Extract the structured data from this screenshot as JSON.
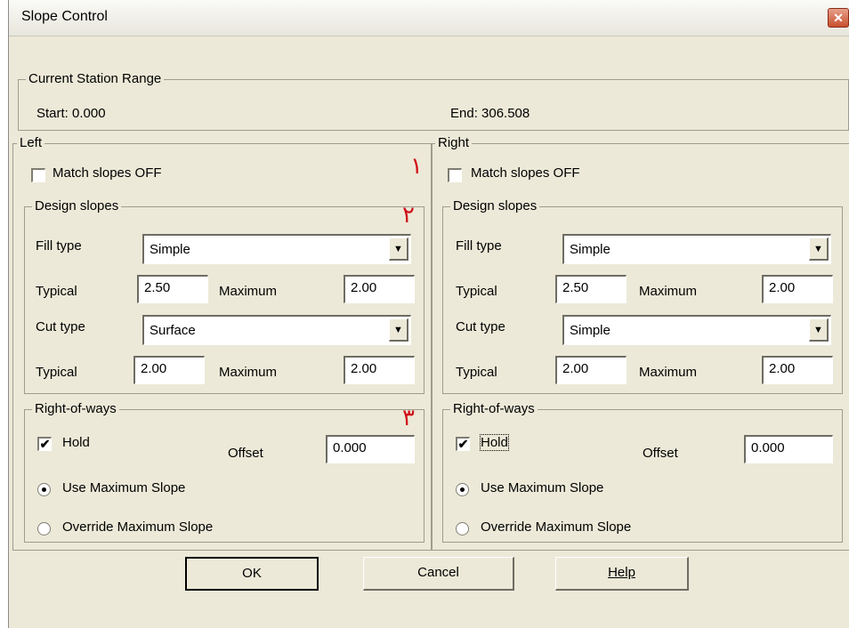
{
  "window": {
    "title": "Slope Control",
    "close_glyph": "✕"
  },
  "station": {
    "label": "Current Station Range",
    "start": "Start: 0.000",
    "end": "End: 306.508"
  },
  "left": {
    "label": "Left",
    "marker1": "١",
    "match": "Match slopes OFF",
    "design": {
      "label": "Design slopes",
      "marker": "٢",
      "fill_type_label": "Fill type",
      "fill_type_value": "Simple",
      "typical_label": "Typical",
      "fill_typical": "2.50",
      "maximum_label": "Maximum",
      "fill_maximum": "2.00",
      "cut_type_label": "Cut type",
      "cut_type_value": "Surface",
      "cut_typical": "2.00",
      "cut_maximum": "2.00"
    },
    "row": {
      "label": "Right-of-ways",
      "marker": "٣",
      "hold": "Hold",
      "hold_checked": "✔",
      "offset_label": "Offset",
      "offset_value": "0.000",
      "use_max": "Use Maximum Slope",
      "override_max": "Override Maximum Slope"
    }
  },
  "right": {
    "label": "Right",
    "match": "Match slopes OFF",
    "design": {
      "label": "Design slopes",
      "fill_type_label": "Fill type",
      "fill_type_value": "Simple",
      "typical_label": "Typical",
      "fill_typical": "2.50",
      "maximum_label": "Maximum",
      "fill_maximum": "2.00",
      "cut_type_label": "Cut type",
      "cut_type_value": "Simple",
      "cut_typical": "2.00",
      "cut_maximum": "2.00"
    },
    "row": {
      "label": "Right-of-ways",
      "hold": "Hold",
      "hold_checked": "✔",
      "offset_label": "Offset",
      "offset_value": "0.000",
      "use_max": "Use Maximum Slope",
      "override_max": "Override Maximum Slope"
    }
  },
  "buttons": {
    "ok": "OK",
    "cancel": "Cancel",
    "help": "Help"
  },
  "icons": {
    "dropdown": "▼"
  }
}
